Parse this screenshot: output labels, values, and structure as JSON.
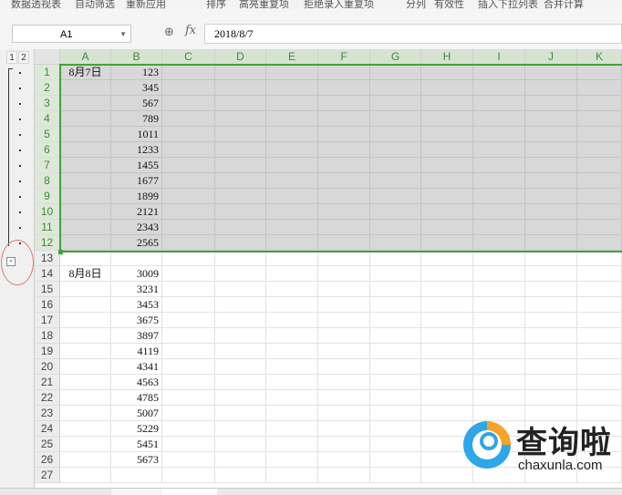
{
  "ribbon": {
    "items": [
      "数据透视表",
      "自动筛选",
      "重新应用",
      "排序",
      "高亮重复项",
      "拒绝录入重复项",
      "分列",
      "有效性",
      "插入下拉列表",
      "合并计算"
    ]
  },
  "formula_bar": {
    "name_box": "A1",
    "formula": "2018/8/7"
  },
  "outline": {
    "levels": [
      "1",
      "2"
    ],
    "collapse_symbol": "-"
  },
  "columns": [
    "A",
    "B",
    "C",
    "D",
    "E",
    "F",
    "G",
    "H",
    "I",
    "J",
    "K"
  ],
  "rows": [
    {
      "n": "1",
      "a": "8月7日",
      "b": "123"
    },
    {
      "n": "2",
      "a": "",
      "b": "345"
    },
    {
      "n": "3",
      "a": "",
      "b": "567"
    },
    {
      "n": "4",
      "a": "",
      "b": "789"
    },
    {
      "n": "5",
      "a": "",
      "b": "1011"
    },
    {
      "n": "6",
      "a": "",
      "b": "1233"
    },
    {
      "n": "7",
      "a": "",
      "b": "1455"
    },
    {
      "n": "8",
      "a": "",
      "b": "1677"
    },
    {
      "n": "9",
      "a": "",
      "b": "1899"
    },
    {
      "n": "10",
      "a": "",
      "b": "2121"
    },
    {
      "n": "11",
      "a": "",
      "b": "2343"
    },
    {
      "n": "12",
      "a": "",
      "b": "2565"
    },
    {
      "n": "13",
      "a": "",
      "b": ""
    },
    {
      "n": "14",
      "a": "8月8日",
      "b": "3009"
    },
    {
      "n": "15",
      "a": "",
      "b": "3231"
    },
    {
      "n": "16",
      "a": "",
      "b": "3453"
    },
    {
      "n": "17",
      "a": "",
      "b": "3675"
    },
    {
      "n": "18",
      "a": "",
      "b": "3897"
    },
    {
      "n": "19",
      "a": "",
      "b": "4119"
    },
    {
      "n": "20",
      "a": "",
      "b": "4341"
    },
    {
      "n": "21",
      "a": "",
      "b": "4563"
    },
    {
      "n": "22",
      "a": "",
      "b": "4785"
    },
    {
      "n": "23",
      "a": "",
      "b": "5007"
    },
    {
      "n": "24",
      "a": "",
      "b": "5229"
    },
    {
      "n": "25",
      "a": "",
      "b": "5451"
    },
    {
      "n": "26",
      "a": "",
      "b": "5673"
    },
    {
      "n": "27",
      "a": "",
      "b": ""
    }
  ],
  "selected_rows": 12,
  "watermark": {
    "cn": "查询啦",
    "en": "chaxunla.com"
  },
  "colors": {
    "selection": "#3fa33b",
    "selected_fill": "#d8d8d8",
    "annotation_circle": "#e07878"
  }
}
